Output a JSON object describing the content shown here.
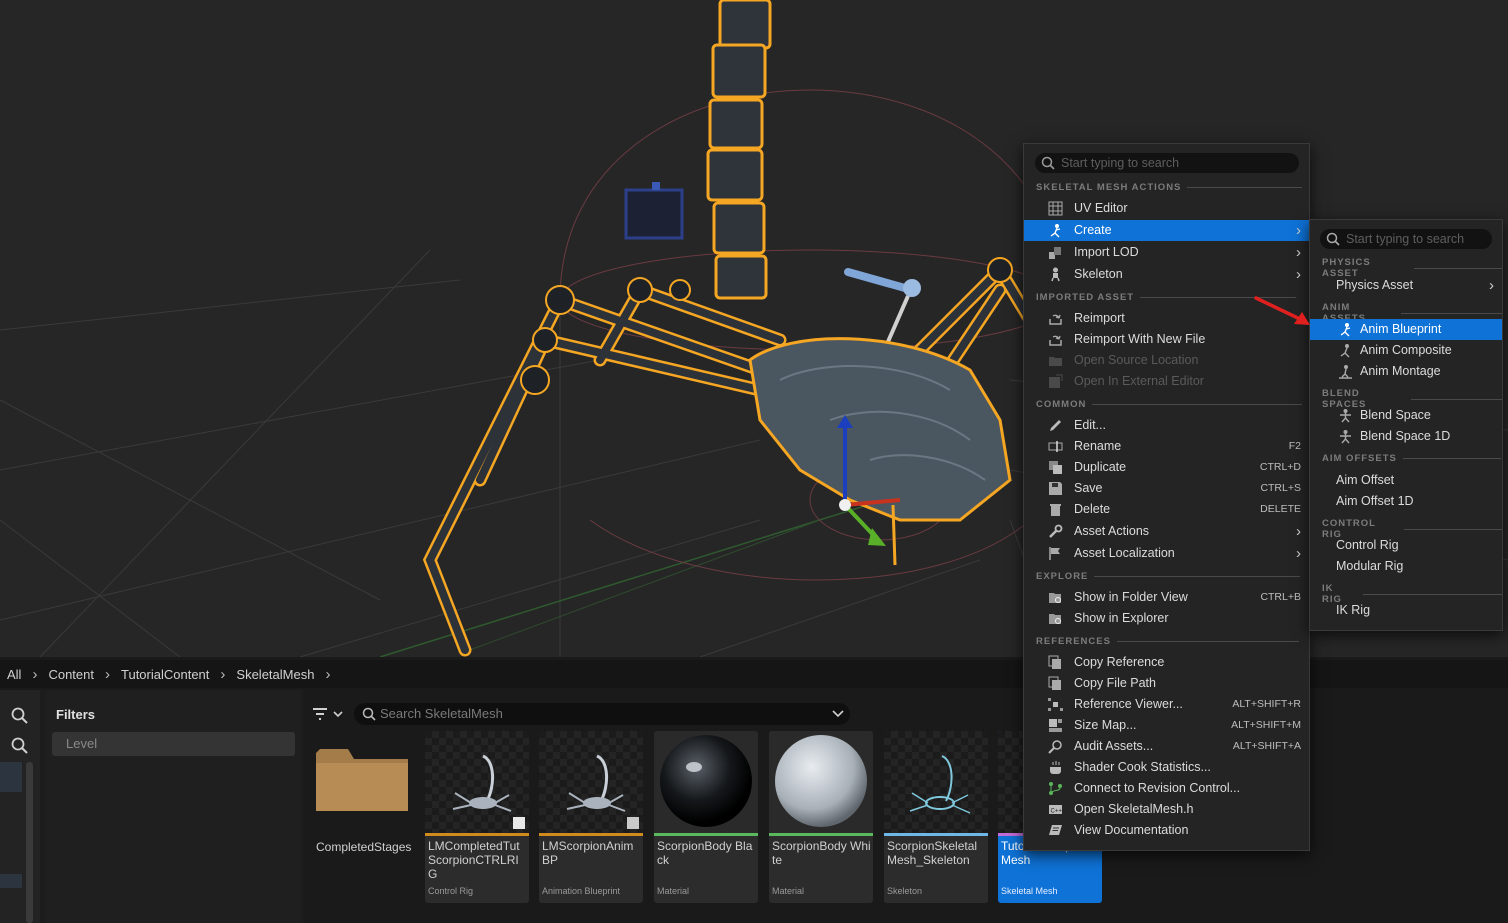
{
  "breadcrumb": [
    "All",
    "Content",
    "TutorialContent",
    "SkeletalMesh"
  ],
  "filters": {
    "title": "Filters",
    "level_placeholder": "Level"
  },
  "asset_search": {
    "placeholder": "Search SkeletalMesh"
  },
  "assets": [
    {
      "name": "CompletedStages",
      "type": "",
      "kind": "folder"
    },
    {
      "name": "LMCompletedTut ScorpionCTRLRIG",
      "type": "Control Rig",
      "bar": "#d08a1e"
    },
    {
      "name": "LMScorpionAnim BP",
      "type": "Animation Blueprint",
      "bar": "#d08a1e"
    },
    {
      "name": "ScorpionBody Black",
      "type": "Material",
      "bar": "#5cb85c"
    },
    {
      "name": "ScorpionBody White",
      "type": "Material",
      "bar": "#5cb85c"
    },
    {
      "name": "ScorpionSkeletal Mesh_Skeleton",
      "type": "Skeleton",
      "bar": "#6fb7e6"
    },
    {
      "name": "TutorialScorpion Mesh",
      "type": "Skeletal Mesh",
      "bar": "#c26bd6"
    }
  ],
  "menu": {
    "search_placeholder": "Start typing to search",
    "sections": {
      "skeletal": "SKELETAL MESH ACTIONS",
      "imported": "IMPORTED ASSET",
      "common": "COMMON",
      "explore": "EXPLORE",
      "references": "REFERENCES"
    },
    "items": {
      "uv_editor": "UV Editor",
      "create": "Create",
      "import_lod": "Import LOD",
      "skeleton": "Skeleton",
      "reimport": "Reimport",
      "reimport_new": "Reimport With New File",
      "open_source": "Open Source Location",
      "open_external": "Open In External Editor",
      "edit": "Edit...",
      "rename": "Rename",
      "duplicate": "Duplicate",
      "save": "Save",
      "delete": "Delete",
      "asset_actions": "Asset Actions",
      "asset_localization": "Asset Localization",
      "show_folder": "Show in Folder View",
      "show_explorer": "Show in Explorer",
      "copy_reference": "Copy Reference",
      "copy_file_path": "Copy File Path",
      "reference_viewer": "Reference Viewer...",
      "size_map": "Size Map...",
      "audit_assets": "Audit Assets...",
      "shader_cook": "Shader Cook Statistics...",
      "revision_control": "Connect to Revision Control...",
      "open_header": "Open SkeletalMesh.h",
      "view_docs": "View Documentation"
    },
    "shortcuts": {
      "rename": "F2",
      "duplicate": "CTRL+D",
      "save": "CTRL+S",
      "delete": "DELETE",
      "show_folder": "CTRL+B",
      "reference_viewer": "ALT+SHIFT+R",
      "size_map": "ALT+SHIFT+M",
      "audit_assets": "ALT+SHIFT+A"
    }
  },
  "submenu": {
    "search_placeholder": "Start typing to search",
    "sections": {
      "physics": "PHYSICS ASSET",
      "anim": "ANIM ASSETS",
      "blend": "BLEND SPACES",
      "aim": "AIM OFFSETS",
      "control": "CONTROL RIG",
      "ik": "IK RIG"
    },
    "items": {
      "physics_asset": "Physics Asset",
      "anim_blueprint": "Anim Blueprint",
      "anim_composite": "Anim Composite",
      "anim_montage": "Anim Montage",
      "blend_space": "Blend Space",
      "blend_space_1d": "Blend Space 1D",
      "aim_offset": "Aim Offset",
      "aim_offset_1d": "Aim Offset 1D",
      "control_rig": "Control Rig",
      "modular_rig": "Modular Rig",
      "ik_rig": "IK Rig"
    }
  },
  "colors": {
    "highlight": "#0e72d6",
    "selection_outline": "#f5a623",
    "annotation_arrow": "#e0201f"
  }
}
